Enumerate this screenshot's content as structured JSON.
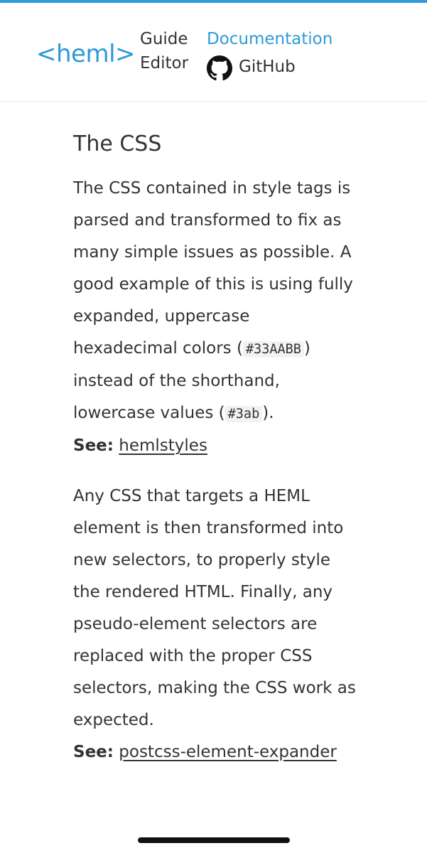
{
  "brand": {
    "accent_color": "#2f9ad8",
    "logo_text": "<heml>"
  },
  "nav": {
    "guide": "Guide",
    "editor": "Editor",
    "documentation": "Documentation",
    "github": "GitHub",
    "github_icon": "github-octocat-icon"
  },
  "section": {
    "title": "The CSS",
    "para1": {
      "part1": "The CSS contained in style tags is parsed and transformed to fix as many simple issues as possible. A good example of this is using fully expanded, uppercase hexadecimal colors (",
      "code1": "#33AABB",
      "part2": ") instead of the shorthand, lowercase values (",
      "code2": "#3ab",
      "part3": ")."
    },
    "see1": {
      "label": "See:",
      "link": "hemlstyles"
    },
    "para2": "Any CSS that targets a HEML element is then transformed into new selectors, to properly style the rendered HTML. Finally, any pseudo-element selectors are replaced with the proper CSS selectors, making the CSS work as expected.",
    "see2": {
      "label": "See:",
      "link": "postcss-element-expander"
    }
  }
}
